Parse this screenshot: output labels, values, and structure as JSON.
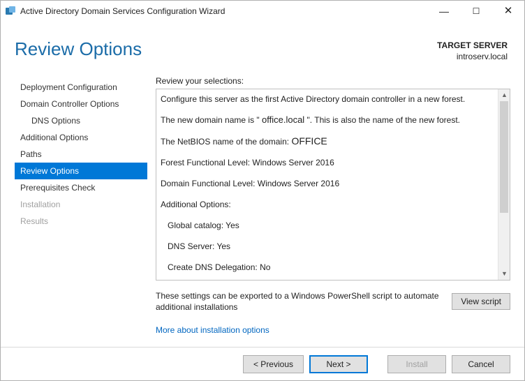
{
  "window": {
    "title": "Active Directory Domain Services Configuration Wizard"
  },
  "header": {
    "page_title": "Review Options",
    "target_label": "TARGET SERVER",
    "target_value": "introserv.local"
  },
  "sidebar": {
    "items": [
      {
        "label": "Deployment Configuration",
        "state": "normal"
      },
      {
        "label": "Domain Controller Options",
        "state": "normal"
      },
      {
        "label": "DNS Options",
        "state": "indent"
      },
      {
        "label": "Additional Options",
        "state": "normal"
      },
      {
        "label": "Paths",
        "state": "normal"
      },
      {
        "label": "Review Options",
        "state": "selected"
      },
      {
        "label": "Prerequisites Check",
        "state": "normal"
      },
      {
        "label": "Installation",
        "state": "disabled"
      },
      {
        "label": "Results",
        "state": "disabled"
      }
    ]
  },
  "main": {
    "review_label": "Review your selections:",
    "review_lines": {
      "l1a": "Configure this server as the first Active Directory domain controller in a new forest.",
      "l2a": "The new domain name is \" ",
      "l2b": "office.local",
      "l2c": " \". This is also the name of the new forest.",
      "l3a": "The NetBIOS name of the domain: ",
      "l3b": "OFFICE",
      "l4": "Forest Functional Level: Windows Server 2016",
      "l5": "Domain Functional Level: Windows Server 2016",
      "l6": "Additional Options:",
      "l7": "Global catalog: Yes",
      "l8": "DNS Server: Yes",
      "l9": "Create DNS Delegation: No"
    },
    "export_text": "These settings can be exported to a Windows PowerShell script to automate additional installations",
    "view_script": "View script",
    "more_link": "More about installation options"
  },
  "footer": {
    "previous": "< Previous",
    "next": "Next >",
    "install": "Install",
    "cancel": "Cancel"
  }
}
